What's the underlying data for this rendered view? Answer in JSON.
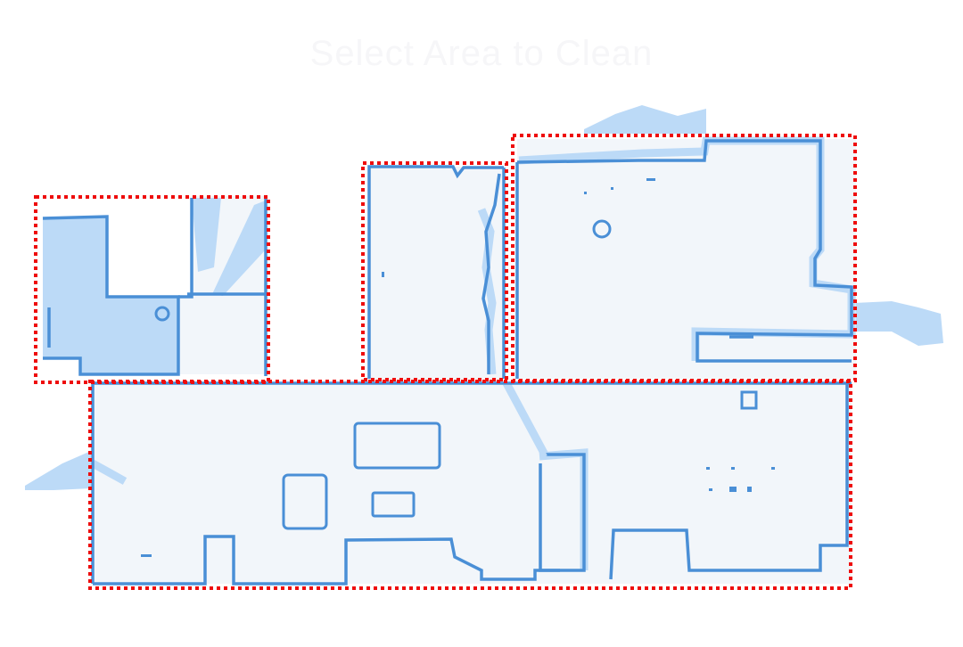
{
  "header": {
    "title": "Select Area to Clean"
  },
  "colors": {
    "wall": "#4a8fd6",
    "floor": "#f2f6fa",
    "selected_floor": "#bcdaf7",
    "zone_border": "#ee0c0c"
  },
  "zones": [
    {
      "id": "zone-1",
      "selected": true
    },
    {
      "id": "zone-2",
      "selected": false
    },
    {
      "id": "zone-3",
      "selected": false
    },
    {
      "id": "zone-4",
      "selected": false
    }
  ]
}
